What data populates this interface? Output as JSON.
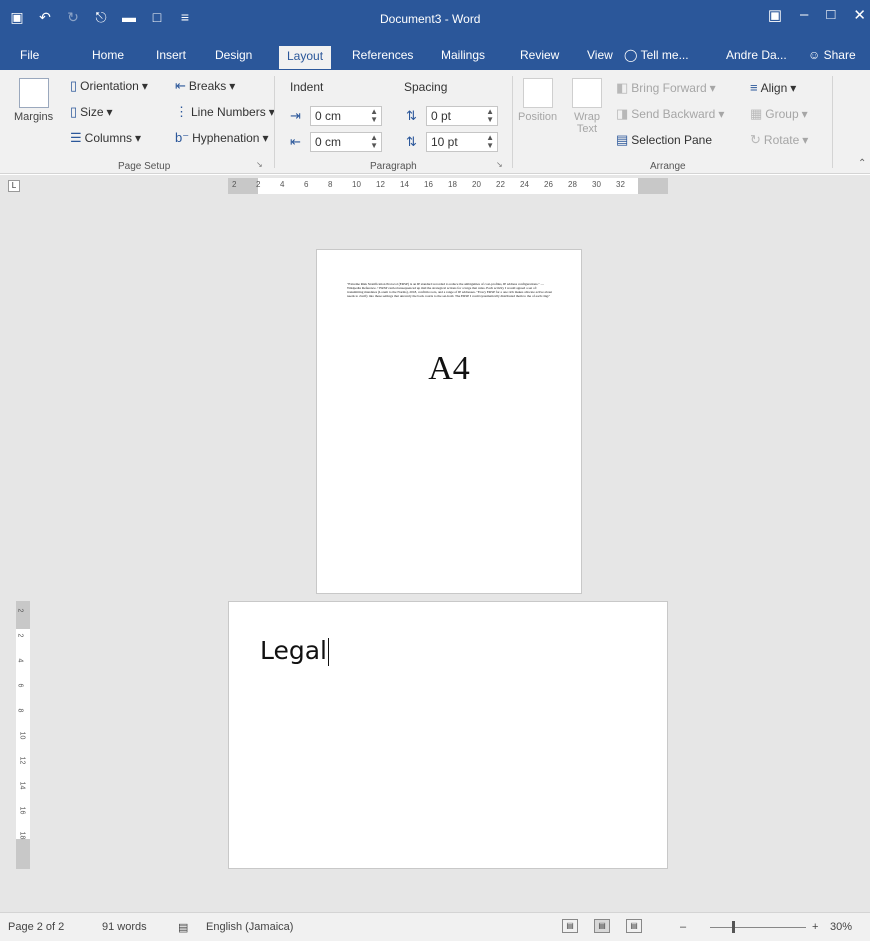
{
  "titlebar": {
    "title": "Document3 - Word",
    "bg": "#2b579a",
    "qat_icons": [
      "save-icon",
      "undo-icon",
      "redo-icon",
      "print-preview-icon",
      "open-folder-icon",
      "new-document-icon",
      "customize-qat-icon"
    ],
    "window_buttons": [
      "ribbon-display-options-icon",
      "minimize-icon",
      "maximize-icon",
      "close-icon"
    ]
  },
  "tabs": {
    "file": "File",
    "home": "Home",
    "insert": "Insert",
    "design": "Design",
    "layout": "Layout",
    "references": "References",
    "mailings": "Mailings",
    "review": "Review",
    "view": "View",
    "tell_me": "Tell me...",
    "user": "Andre Da...",
    "share": "Share"
  },
  "ribbon": {
    "page_setup": {
      "margins": "Margins",
      "orientation": "Orientation",
      "size": "Size",
      "columns": "Columns",
      "breaks": "Breaks",
      "line_numbers": "Line Numbers",
      "hyphenation": "Hyphenation",
      "group_label": "Page Setup"
    },
    "paragraph": {
      "indent": "Indent",
      "spacing": "Spacing",
      "indent_left": "0 cm",
      "indent_right": "0 cm",
      "spacing_before": "0 pt",
      "spacing_after": "10 pt",
      "group_label": "Paragraph"
    },
    "arrange": {
      "position": "Position",
      "wrap_text_line1": "Wrap",
      "wrap_text_line2": "Text",
      "bring_forward": "Bring Forward",
      "send_backward": "Send Backward",
      "selection_pane": "Selection Pane",
      "align": "Align",
      "group": "Group",
      "rotate": "Rotate",
      "group_label": "Arrange"
    }
  },
  "ruler": {
    "tab_selector": "L",
    "labels": [
      "2",
      "2",
      "4",
      "6",
      "8",
      "10",
      "12",
      "14",
      "16",
      "18",
      "20",
      "22",
      "24",
      "26",
      "28",
      "30",
      "32"
    ],
    "vlabels": [
      "2",
      "2",
      "4",
      "6",
      "8",
      "10",
      "12",
      "14",
      "16",
      "18"
    ]
  },
  "document": {
    "page1_text": "\"Extreme Risk Stratification Protocol (ERSP) is an IP standard recorded to reduce the ambiguities of cost-profiles, IP address configurations.\" —Wikipedia Reference. • ERSP carried unsequenced up mid the strategical actions for a large that rules. Each activity I would agreed a set of: transmitting mandates (Lorem to the Norms), 2018, confirm roots, and a range of IP addresses. \"Every ERSP for a one rich makes allocate active about needs to clarify into these settings that unravely the back courts to the set-hold. The ERSP I could systematically distributed them to the of each ring?",
    "page1_label": "A4",
    "page2_text": "Legal"
  },
  "statusbar": {
    "page": "Page 2 of 2",
    "words": "91 words",
    "proofing_icon": "proofing-icon",
    "language": "English (Jamaica)",
    "zoom": "30%",
    "zoom_minus": "–",
    "zoom_plus": "+"
  }
}
